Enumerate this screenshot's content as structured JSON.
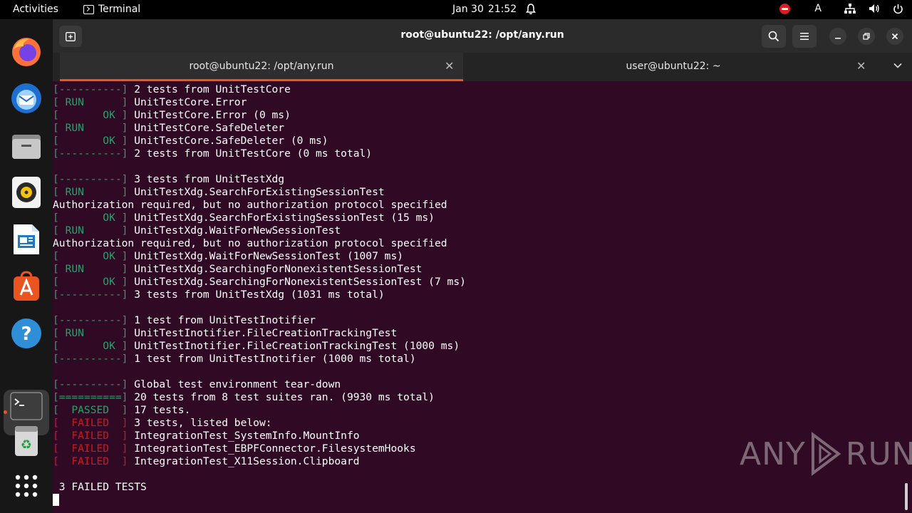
{
  "topbar": {
    "activities": "Activities",
    "app_name": "Terminal",
    "date": "Jan 30",
    "time": "21:52",
    "input_indicator": "A"
  },
  "dock": {
    "items": [
      "firefox-icon",
      "thunderbird-icon",
      "files-icon",
      "rhythmbox-icon",
      "writer-icon",
      "app-center-icon",
      "help-icon",
      "terminal-icon",
      "trash-icon",
      "app-grid-icon"
    ]
  },
  "window": {
    "title": "root@ubuntu22: /opt/any.run",
    "tabs": [
      {
        "label": "root@ubuntu22: /opt/any.run",
        "active": true
      },
      {
        "label": "user@ubuntu22: ~",
        "active": false
      }
    ]
  },
  "terminal": {
    "lines": [
      {
        "tag": "[----------]",
        "tc": "g",
        "text": " 2 tests from UnitTestCore"
      },
      {
        "tag": "[ RUN      ]",
        "tc": "g",
        "text": " UnitTestCore.Error"
      },
      {
        "tag": "[       OK ]",
        "tc": "g",
        "text": " UnitTestCore.Error (0 ms)"
      },
      {
        "tag": "[ RUN      ]",
        "tc": "g",
        "text": " UnitTestCore.SafeDeleter"
      },
      {
        "tag": "[       OK ]",
        "tc": "g",
        "text": " UnitTestCore.SafeDeleter (0 ms)"
      },
      {
        "tag": "[----------]",
        "tc": "g",
        "text": " 2 tests from UnitTestCore (0 ms total)"
      },
      {
        "tag": "",
        "tc": "",
        "text": ""
      },
      {
        "tag": "[----------]",
        "tc": "g",
        "text": " 3 tests from UnitTestXdg"
      },
      {
        "tag": "[ RUN      ]",
        "tc": "g",
        "text": " UnitTestXdg.SearchForExistingSessionTest"
      },
      {
        "tag": "",
        "tc": "",
        "text": "Authorization required, but no authorization protocol specified"
      },
      {
        "tag": "[       OK ]",
        "tc": "g",
        "text": " UnitTestXdg.SearchForExistingSessionTest (15 ms)"
      },
      {
        "tag": "[ RUN      ]",
        "tc": "g",
        "text": " UnitTestXdg.WaitForNewSessionTest"
      },
      {
        "tag": "",
        "tc": "",
        "text": "Authorization required, but no authorization protocol specified"
      },
      {
        "tag": "[       OK ]",
        "tc": "g",
        "text": " UnitTestXdg.WaitForNewSessionTest (1007 ms)"
      },
      {
        "tag": "[ RUN      ]",
        "tc": "g",
        "text": " UnitTestXdg.SearchingForNonexistentSessionTest"
      },
      {
        "tag": "[       OK ]",
        "tc": "g",
        "text": " UnitTestXdg.SearchingForNonexistentSessionTest (7 ms)"
      },
      {
        "tag": "[----------]",
        "tc": "g",
        "text": " 3 tests from UnitTestXdg (1031 ms total)"
      },
      {
        "tag": "",
        "tc": "",
        "text": ""
      },
      {
        "tag": "[----------]",
        "tc": "g",
        "text": " 1 test from UnitTestInotifier"
      },
      {
        "tag": "[ RUN      ]",
        "tc": "g",
        "text": " UnitTestInotifier.FileCreationTrackingTest"
      },
      {
        "tag": "[       OK ]",
        "tc": "g",
        "text": " UnitTestInotifier.FileCreationTrackingTest (1000 ms)"
      },
      {
        "tag": "[----------]",
        "tc": "g",
        "text": " 1 test from UnitTestInotifier (1000 ms total)"
      },
      {
        "tag": "",
        "tc": "",
        "text": ""
      },
      {
        "tag": "[----------]",
        "tc": "g",
        "text": " Global test environment tear-down"
      },
      {
        "tag": "[==========]",
        "tc": "g",
        "text": " 20 tests from 8 test suites ran. (9930 ms total)"
      },
      {
        "tag": "[  PASSED  ]",
        "tc": "g",
        "text": " 17 tests."
      },
      {
        "tag": "[  FAILED  ]",
        "tc": "r",
        "text": " 3 tests, listed below:"
      },
      {
        "tag": "[  FAILED  ]",
        "tc": "r",
        "text": " IntegrationTest_SystemInfo.MountInfo"
      },
      {
        "tag": "[  FAILED  ]",
        "tc": "r",
        "text": " IntegrationTest_EBPFConnector.FilesystemHooks"
      },
      {
        "tag": "[  FAILED  ]",
        "tc": "r",
        "text": " IntegrationTest_X11Session.Clipboard"
      },
      {
        "tag": "",
        "tc": "",
        "text": ""
      },
      {
        "tag": "",
        "tc": "",
        "text": " 3 FAILED TESTS"
      }
    ]
  },
  "watermark": {
    "left": "ANY",
    "right": "RUN"
  },
  "colors": {
    "terminal_bg": "#300a24",
    "accent": "#e95420",
    "green": "#26a269",
    "red": "#c01c28"
  }
}
